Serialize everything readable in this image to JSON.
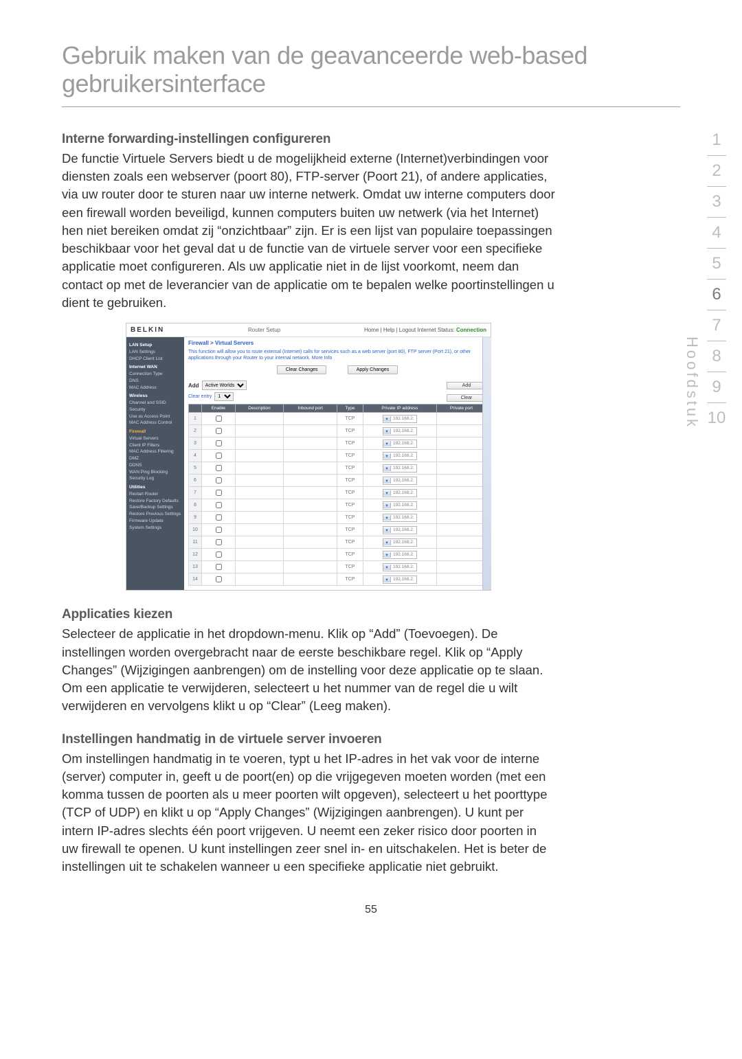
{
  "title": "Gebruik maken van de geavanceerde web-based gebruikersinterface",
  "section1_heading": "Interne forwarding-instellingen configureren",
  "section1_body": "De functie Virtuele Servers biedt u de mogelijkheid externe (Internet)verbindingen voor diensten zoals een webserver (poort 80), FTP-server (Poort 21), of andere applicaties, via uw router door te sturen naar uw interne netwerk. Omdat uw interne computers door een firewall worden beveiligd, kunnen computers buiten uw netwerk (via het Internet) hen niet bereiken omdat zij “onzichtbaar” zijn. Er is een lijst van populaire toepassingen beschikbaar voor het geval dat u de functie van de virtuele server voor een specifieke applicatie moet configureren. Als uw applicatie niet in de lijst voorkomt, neem dan contact op met de leverancier van de applicatie om te bepalen welke poortinstellingen u dient te gebruiken.",
  "section2_heading": "Applicaties kiezen",
  "section2_body": "Selecteer de applicatie in het dropdown-menu. Klik op “Add” (Toevoegen). De instellingen worden overgebracht naar de eerste beschikbare regel. Klik op “Apply Changes” (Wijzigingen aanbrengen) om de instelling voor deze applicatie op te slaan. Om een applicatie te verwijderen, selecteert u het nummer van de regel die u wilt verwijderen en vervolgens klikt u op “Clear” (Leeg maken).",
  "section3_heading": "Instellingen handmatig in de virtuele server invoeren",
  "section3_body": "Om instellingen handmatig in te voeren, typt u het IP-adres in het vak voor de interne (server) computer in, geeft u de poort(en) op die vrijgegeven moeten worden (met een komma tussen de poorten als u meer poorten wilt opgeven), selecteert u het poorttype (TCP of UDP) en klikt u op “Apply Changes” (Wijzigingen aanbrengen). U kunt per intern IP-adres slechts één poort vrijgeven. U neemt een zeker risico door poorten in uw firewall te openen. U kunt instellingen zeer snel in- en uitschakelen. Het is beter de instellingen uit te schakelen wanneer u een specifieke applicatie niet gebruikt.",
  "page_number": "55",
  "chapter_label": "Hoofdstuk",
  "nav": [
    "1",
    "2",
    "3",
    "4",
    "5",
    "6",
    "7",
    "8",
    "9",
    "10"
  ],
  "nav_active": "6",
  "router": {
    "brand": "BELKIN",
    "setup": "Router Setup",
    "status_links": "Home | Help | Logout   Internet Status:",
    "status_state": "Connection",
    "breadcrumb": "Firewall > Virtual Servers",
    "description": "This function will allow you to route external (Internet) calls for services such as a web server (port 80), FTP server (Port 21), or other applications through your Router to your internal network.",
    "more_info": "More Info",
    "clear_changes": "Clear Changes",
    "apply_changes": "Apply Changes",
    "add_label": "Add",
    "add_select": "Active Worlds",
    "add_btn": "Add",
    "clear_label": "Clear entry",
    "clear_select": "1",
    "clear_btn": "Clear",
    "headers": [
      "",
      "Enable",
      "Description",
      "Inbound port",
      "Type",
      "Private IP address",
      "Private port"
    ],
    "type_value": "TCP",
    "ip_prefix": "192.168.2.",
    "rows": [
      1,
      2,
      3,
      4,
      5,
      6,
      7,
      8,
      9,
      10,
      11,
      12,
      13,
      14
    ],
    "sidebar": {
      "groups": [
        {
          "hd": "LAN Setup",
          "items": [
            "LAN Settings",
            "DHCP Client List"
          ]
        },
        {
          "hd": "Internet WAN",
          "items": [
            "Connection Type",
            "DNS",
            "MAC Address"
          ]
        },
        {
          "hd": "Wireless",
          "items": [
            "Channel and SSID",
            "Security",
            "Use as Access Point",
            "MAC Address Control"
          ]
        },
        {
          "hd_fire": "Firewall",
          "items": [
            "Virtual Servers",
            "Client IP Filters",
            "MAC Address Filtering",
            "DMZ",
            "DDNS",
            "WAN Ping Blocking",
            "Security Log"
          ]
        },
        {
          "hd": "Utilities",
          "items": [
            "Restart Router",
            "Restore Factory Defaults",
            "Save/Backup Settings",
            "Restore Previous Settings",
            "Firmware Update",
            "System Settings"
          ]
        }
      ]
    }
  }
}
